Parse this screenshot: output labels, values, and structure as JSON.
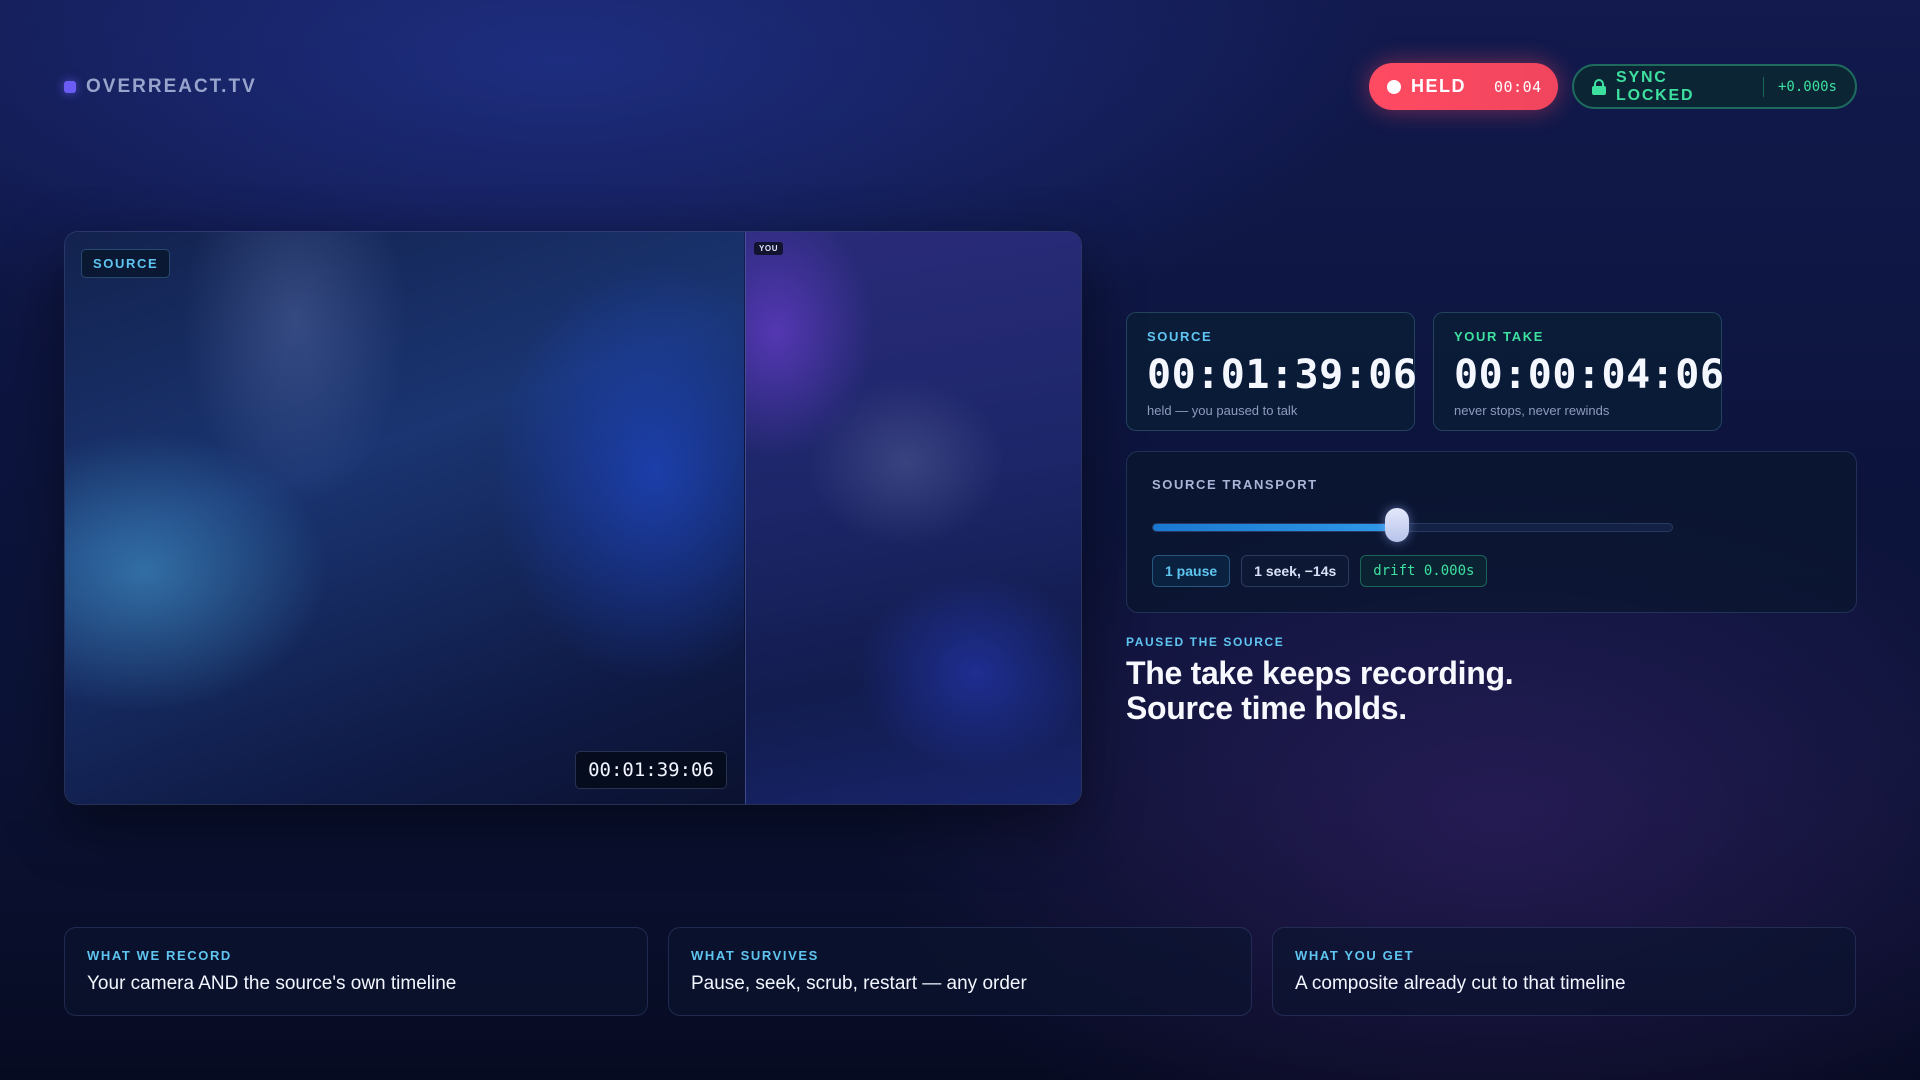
{
  "brand": {
    "name": "OVERREACT.TV"
  },
  "header": {
    "held": {
      "label": "HELD",
      "time": "00:04",
      "color": "#ff4b62"
    },
    "sync": {
      "label": "SYNC LOCKED",
      "drift": "+0.000s",
      "color": "#3ee0a0",
      "icon": "lock-icon"
    }
  },
  "video": {
    "source_tag": "SOURCE",
    "you_tag": "YOU",
    "timecode": "00:01:39:06"
  },
  "timecodes": {
    "source": {
      "label": "SOURCE",
      "value": "00:01:39:06",
      "note": "held — you paused to talk"
    },
    "take": {
      "label": "YOUR TAKE",
      "value": "00:00:04:06",
      "note": "never stops, never rewinds"
    }
  },
  "transport": {
    "label": "SOURCE TRANSPORT",
    "progress": 0.47,
    "chips": {
      "pause": "1 pause",
      "seek": "1 seek, −14s",
      "drift": "drift 0.000s"
    }
  },
  "status": {
    "eyebrow": "PAUSED THE SOURCE",
    "line1": "The take keeps recording.",
    "line2": "Source time holds."
  },
  "features": [
    {
      "label": "WHAT WE RECORD",
      "text": "Your camera AND the source's own timeline"
    },
    {
      "label": "WHAT SURVIVES",
      "text": "Pause, seek, scrub, restart — any order"
    },
    {
      "label": "WHAT YOU GET",
      "text": "A composite already cut to that timeline"
    }
  ],
  "colors": {
    "accent_blue": "#5fc5f0",
    "accent_green": "#3ee0a0",
    "accent_red": "#ff4b62",
    "brand_purple": "#6a5cf5"
  }
}
